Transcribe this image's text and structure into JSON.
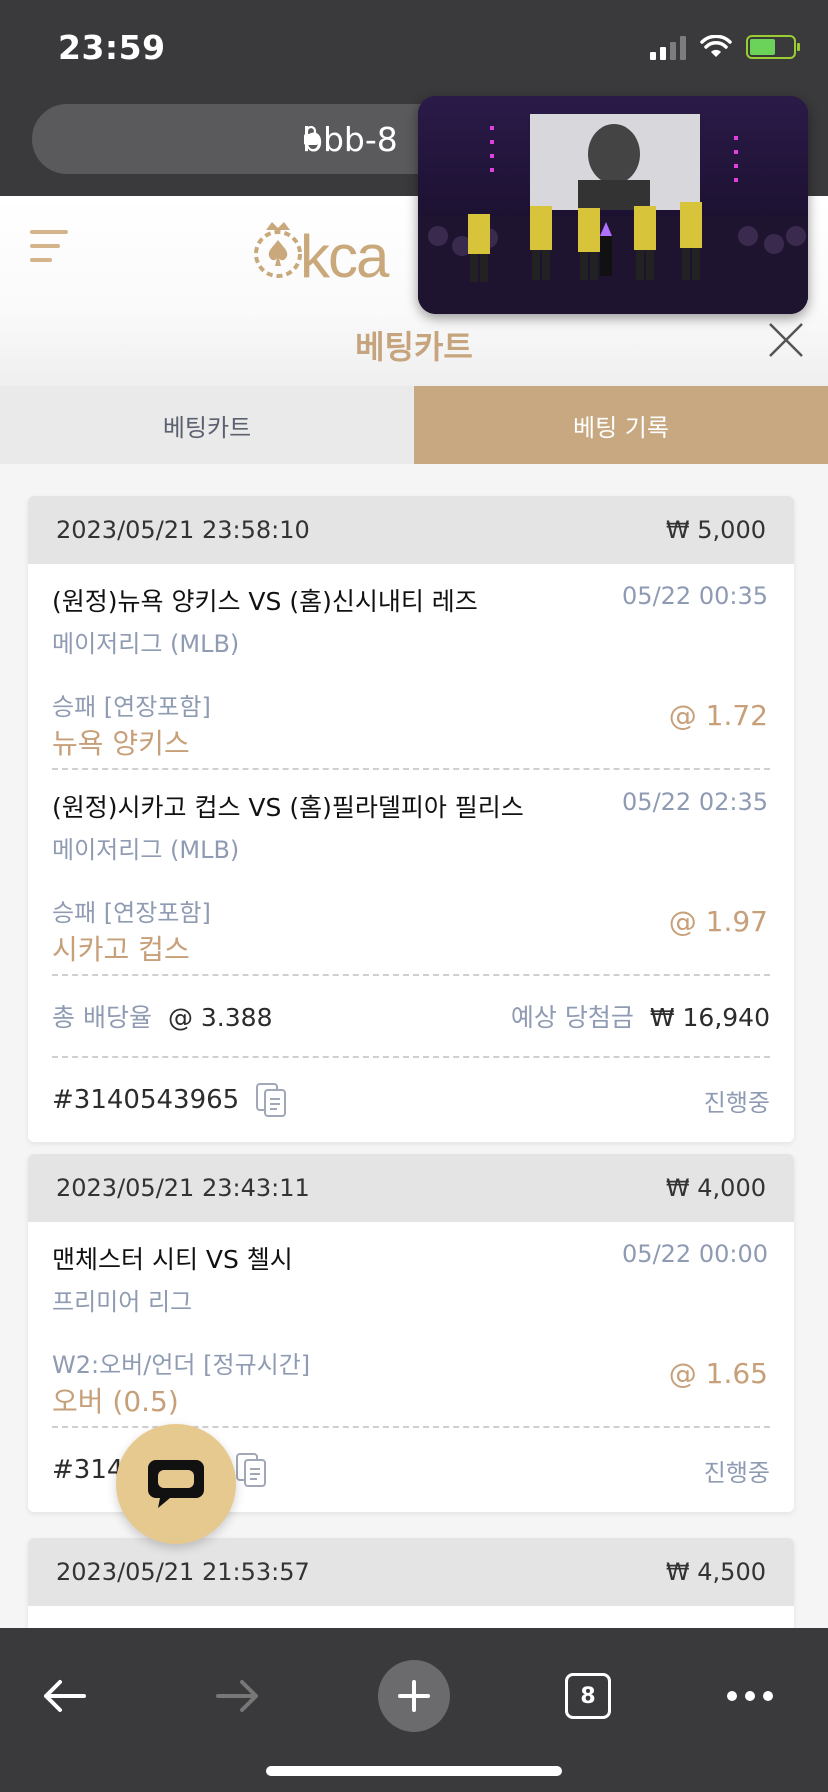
{
  "status_bar": {
    "time": "23:59"
  },
  "browser": {
    "url": "bbb-8",
    "tab_count": "8"
  },
  "header": {
    "logo": "kca",
    "cart_title": "베팅카트"
  },
  "tabs": [
    {
      "label": "베팅카트"
    },
    {
      "label": "베팅 기록"
    }
  ],
  "bets": [
    {
      "datetime": "2023/05/21 23:58:10",
      "stake": "₩ 5,000",
      "matches": [
        {
          "teams": "(원정)뉴욕 양키스 VS (홈)신시내티 레즈",
          "league": "메이저리그 (MLB)",
          "time": "05/22 00:35",
          "market": "승패 [연장포함]",
          "pick": "뉴욕 양키스",
          "odds": "@ 1.72"
        },
        {
          "teams": "(원정)시카고 컵스 VS (홈)필라델피아 필리스",
          "league": "메이저리그 (MLB)",
          "time": "05/22 02:35",
          "market": "승패 [연장포함]",
          "pick": "시카고 컵스",
          "odds": "@ 1.97"
        }
      ],
      "total_odds_label": "총 배당율",
      "total_odds": "@ 3.388",
      "expected_label": "예상 당첨금",
      "expected_win": "₩ 16,940",
      "id": "#3140543965",
      "status": "진행중"
    },
    {
      "datetime": "2023/05/21 23:43:11",
      "stake": "₩ 4,000",
      "matches": [
        {
          "teams": "맨체스터 시티 VS 첼시",
          "league": "프리미어 리그",
          "time": "05/22 00:00",
          "market": "W2:오버/언더 [정규시간]",
          "pick": "오버 (0.5)",
          "odds": "@ 1.65"
        }
      ],
      "id": "#314",
      "status": "진행중"
    },
    {
      "datetime": "2023/05/21 21:53:57",
      "stake": "₩ 4,500"
    }
  ],
  "colors": {
    "accent": "#c7a881",
    "muted": "#8f9bb3",
    "chrome": "#3a3a3c"
  }
}
